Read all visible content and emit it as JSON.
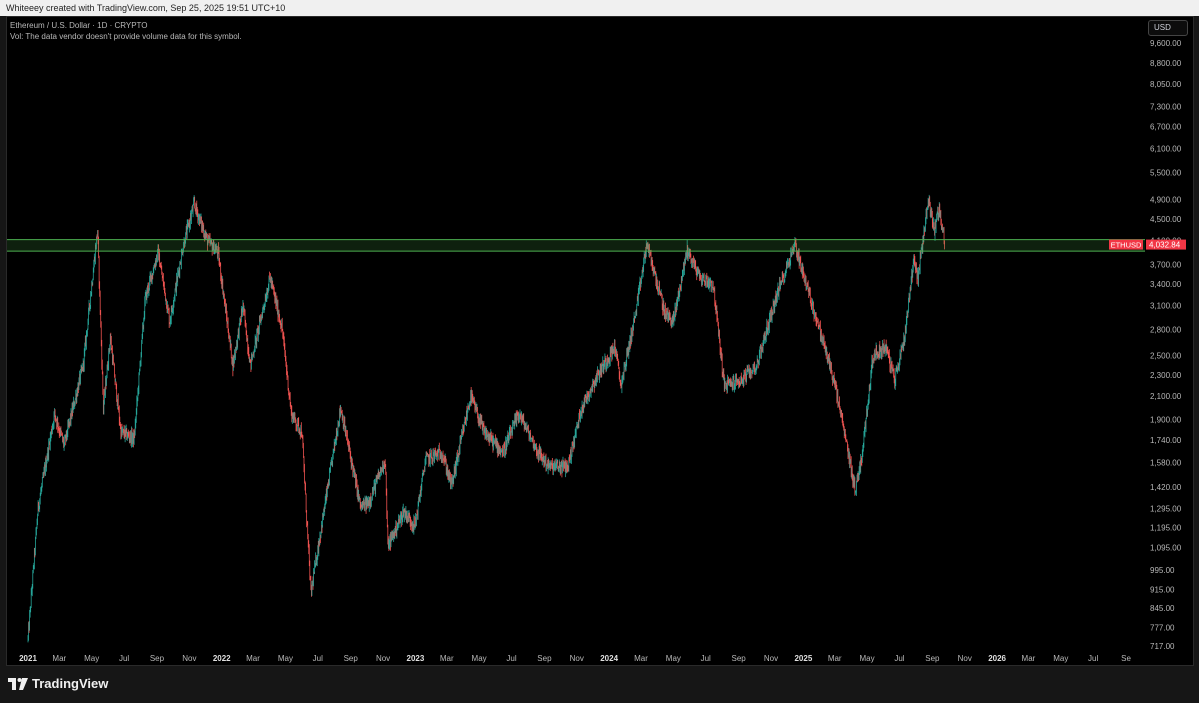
{
  "header": {
    "text": "Whiteeey created with TradingView.com, Sep 25, 2025 19:51 UTC+10"
  },
  "legend": {
    "symbol": "Ethereum / U.S. Dollar · 1D · CRYPTO",
    "vol_note": "Vol: The data vendor doesn't provide volume data for this symbol."
  },
  "currency": "USD",
  "footer": {
    "brand": "TradingView"
  },
  "colors": {
    "up": "#26a69a",
    "down": "#ef5350",
    "zone": "#4caf50",
    "price_label": "#f23645"
  },
  "chart_data": {
    "type": "candlestick",
    "scale": "log",
    "ylim": [
      700,
      10000
    ],
    "y_ticks": [
      "9,600.00",
      "8,800.00",
      "8,050.00",
      "7,300.00",
      "6,700.00",
      "6,100.00",
      "5,500.00",
      "4,900.00",
      "4,500.00",
      "4,100.00",
      "3,700.00",
      "3,400.00",
      "3,100.00",
      "2,800.00",
      "2,500.00",
      "2,300.00",
      "2,100.00",
      "1,900.00",
      "1,740.00",
      "1,580.00",
      "1,420.00",
      "1,295.00",
      "1,195.00",
      "1,095.00",
      "995.00",
      "915.00",
      "845.00",
      "777.00",
      "717.00"
    ],
    "x_labels": [
      "2021",
      "Mar",
      "May",
      "Jul",
      "Sep",
      "Nov",
      "2022",
      "Mar",
      "May",
      "Jul",
      "Sep",
      "Nov",
      "2023",
      "Mar",
      "May",
      "Jul",
      "Sep",
      "Nov",
      "2024",
      "Mar",
      "May",
      "Jul",
      "Sep",
      "Nov",
      "2025",
      "Mar",
      "May",
      "Jul",
      "Sep",
      "Nov",
      "2026",
      "Mar",
      "May",
      "Jul",
      "Se"
    ],
    "x_start": "2021-01-01",
    "x_end": "2026-10-01",
    "key_prices": [
      {
        "date": "2021-01-01",
        "price": 740
      },
      {
        "date": "2021-01-20",
        "price": 1300
      },
      {
        "date": "2021-02-20",
        "price": 1950
      },
      {
        "date": "2021-03-10",
        "price": 1700
      },
      {
        "date": "2021-04-15",
        "price": 2400
      },
      {
        "date": "2021-05-12",
        "price": 4300
      },
      {
        "date": "2021-05-23",
        "price": 2000
      },
      {
        "date": "2021-06-05",
        "price": 2700
      },
      {
        "date": "2021-06-25",
        "price": 1800
      },
      {
        "date": "2021-07-20",
        "price": 1750
      },
      {
        "date": "2021-08-10",
        "price": 3200
      },
      {
        "date": "2021-09-03",
        "price": 3900
      },
      {
        "date": "2021-09-25",
        "price": 2900
      },
      {
        "date": "2021-10-20",
        "price": 4000
      },
      {
        "date": "2021-11-10",
        "price": 4800
      },
      {
        "date": "2021-12-05",
        "price": 4100
      },
      {
        "date": "2021-12-25",
        "price": 3900
      },
      {
        "date": "2022-01-22",
        "price": 2400
      },
      {
        "date": "2022-02-10",
        "price": 3100
      },
      {
        "date": "2022-02-24",
        "price": 2400
      },
      {
        "date": "2022-04-02",
        "price": 3500
      },
      {
        "date": "2022-04-25",
        "price": 2800
      },
      {
        "date": "2022-05-12",
        "price": 1950
      },
      {
        "date": "2022-06-01",
        "price": 1800
      },
      {
        "date": "2022-06-18",
        "price": 900
      },
      {
        "date": "2022-07-05",
        "price": 1150
      },
      {
        "date": "2022-08-13",
        "price": 2000
      },
      {
        "date": "2022-09-20",
        "price": 1300
      },
      {
        "date": "2022-10-05",
        "price": 1330
      },
      {
        "date": "2022-11-05",
        "price": 1600
      },
      {
        "date": "2022-11-10",
        "price": 1100
      },
      {
        "date": "2022-12-10",
        "price": 1280
      },
      {
        "date": "2022-12-31",
        "price": 1200
      },
      {
        "date": "2023-01-20",
        "price": 1600
      },
      {
        "date": "2023-02-20",
        "price": 1650
      },
      {
        "date": "2023-03-10",
        "price": 1430
      },
      {
        "date": "2023-04-15",
        "price": 2100
      },
      {
        "date": "2023-05-10",
        "price": 1800
      },
      {
        "date": "2023-06-15",
        "price": 1650
      },
      {
        "date": "2023-07-15",
        "price": 1950
      },
      {
        "date": "2023-08-20",
        "price": 1650
      },
      {
        "date": "2023-09-10",
        "price": 1550
      },
      {
        "date": "2023-10-15",
        "price": 1550
      },
      {
        "date": "2023-11-10",
        "price": 2000
      },
      {
        "date": "2023-12-10",
        "price": 2300
      },
      {
        "date": "2024-01-12",
        "price": 2600
      },
      {
        "date": "2024-01-23",
        "price": 2200
      },
      {
        "date": "2024-02-20",
        "price": 3000
      },
      {
        "date": "2024-03-12",
        "price": 4050
      },
      {
        "date": "2024-04-15",
        "price": 3000
      },
      {
        "date": "2024-05-01",
        "price": 2900
      },
      {
        "date": "2024-05-27",
        "price": 3950
      },
      {
        "date": "2024-06-20",
        "price": 3500
      },
      {
        "date": "2024-07-15",
        "price": 3400
      },
      {
        "date": "2024-08-05",
        "price": 2200
      },
      {
        "date": "2024-09-07",
        "price": 2250
      },
      {
        "date": "2024-10-05",
        "price": 2400
      },
      {
        "date": "2024-11-10",
        "price": 3200
      },
      {
        "date": "2024-12-16",
        "price": 4050
      },
      {
        "date": "2025-01-10",
        "price": 3300
      },
      {
        "date": "2025-02-05",
        "price": 2700
      },
      {
        "date": "2025-02-25",
        "price": 2300
      },
      {
        "date": "2025-03-10",
        "price": 2000
      },
      {
        "date": "2025-04-09",
        "price": 1400
      },
      {
        "date": "2025-04-22",
        "price": 1650
      },
      {
        "date": "2025-05-12",
        "price": 2500
      },
      {
        "date": "2025-06-05",
        "price": 2600
      },
      {
        "date": "2025-06-22",
        "price": 2250
      },
      {
        "date": "2025-07-10",
        "price": 2700
      },
      {
        "date": "2025-07-28",
        "price": 3800
      },
      {
        "date": "2025-08-05",
        "price": 3500
      },
      {
        "date": "2025-08-24",
        "price": 4900
      },
      {
        "date": "2025-09-05",
        "price": 4300
      },
      {
        "date": "2025-09-13",
        "price": 4700
      },
      {
        "date": "2025-09-25",
        "price": 4032.84
      }
    ],
    "zone": {
      "top": 4120,
      "bottom": 3920
    },
    "last": {
      "symbol": "ETHUSD",
      "price": 4032.84,
      "price_label": "4,032.84"
    }
  }
}
